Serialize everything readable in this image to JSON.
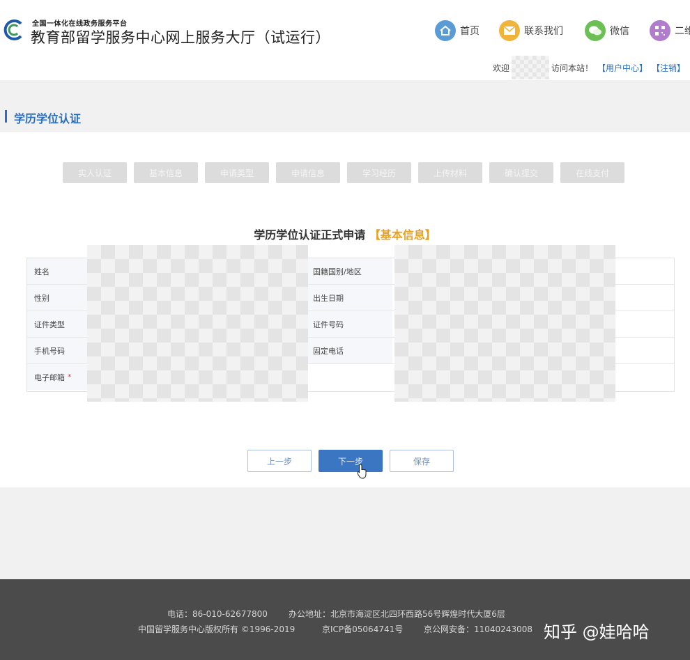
{
  "header": {
    "brand_small": "全国一体化在线政务服务平台",
    "brand_title": "教育部留学服务中心网上服务大厅（试运行）",
    "nav": [
      {
        "label": "首页",
        "icon": "home-icon",
        "color": "#5a9bd5"
      },
      {
        "label": "联系我们",
        "icon": "mail-icon",
        "color": "#f0b43a"
      },
      {
        "label": "微信",
        "icon": "wechat-icon",
        "color": "#6cbf55"
      },
      {
        "label": "二维",
        "icon": "qrcode-icon",
        "color": "#b07ccc"
      }
    ],
    "welcome_prefix": "欢迎",
    "welcome_suffix": "访问本站！",
    "user_center": "【用户中心】",
    "logout": "【注销】"
  },
  "section": {
    "title": "学历学位认证"
  },
  "steps": [
    "实人认证",
    "基本信息",
    "申请类型",
    "申请信息",
    "学习经历",
    "上传材料",
    "确认提交",
    "在线支付"
  ],
  "form": {
    "title": "学历学位认证正式申请",
    "subtitle": "【基本信息】",
    "left_labels": [
      "姓名",
      "性别",
      "证件类型",
      "手机号码",
      "电子邮箱"
    ],
    "right_labels": [
      "国籍国别/地区",
      "出生日期",
      "证件号码",
      "固定电话"
    ],
    "required_mark": "*"
  },
  "buttons": {
    "prev": "上一步",
    "next": "下一步",
    "save": "保存"
  },
  "footer": {
    "phone": "电话：86-010-62677800",
    "address": "办公地址：北京市海淀区北四环西路56号辉煌时代大厦6层",
    "copyright": "中国留学服务中心版权所有 ©1996-2019",
    "icp": "京ICP备05064741号",
    "police": "京公网安备：11040243008"
  },
  "watermark": "知乎 @娃哈哈",
  "colors": {
    "accent": "#2a6ebd",
    "primary_button": "#3b76c2",
    "highlight": "#e8a020",
    "footer_bg": "#4b4b4b"
  }
}
